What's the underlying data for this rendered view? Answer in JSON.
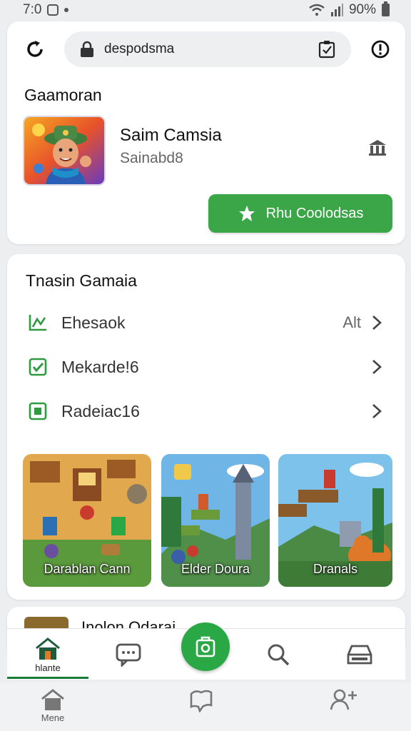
{
  "status_bar": {
    "time": "7:0",
    "battery_text": "90%"
  },
  "browser": {
    "url": "despodsma",
    "icons": [
      "reload-icon",
      "lock-icon",
      "clipboard-check-icon",
      "alert-icon"
    ]
  },
  "featured": {
    "section_title": "Gaamoran",
    "app_name": "Saim Camsia",
    "app_subtitle": "Sainabd8",
    "install_label": "Rhu Coolodsas",
    "accent": "#3ba647"
  },
  "trending": {
    "section_title": "Tnasin Gamaia",
    "items": [
      {
        "label": "Ehesaok",
        "value": "Alt",
        "icon": "chart-icon"
      },
      {
        "label": "Mekarde!6",
        "value": "",
        "icon": "check-square-icon"
      },
      {
        "label": "Radeiac16",
        "value": "",
        "icon": "square-icon"
      }
    ],
    "games": [
      {
        "caption": "Darablan Cann"
      },
      {
        "caption": "Elder Doura"
      },
      {
        "caption": "Dranals"
      }
    ]
  },
  "peek": {
    "title": "Inolon Odarai"
  },
  "app_nav": {
    "tabs": [
      {
        "label": "hlante",
        "icon": "home-icon"
      },
      {
        "label": "",
        "icon": "chat-icon"
      },
      {
        "label": "",
        "icon": "camera-icon"
      },
      {
        "label": "",
        "icon": "search-icon"
      },
      {
        "label": "",
        "icon": "inbox-icon"
      }
    ]
  },
  "system_nav": {
    "tabs": [
      {
        "label": "Mene",
        "icon": "home-icon"
      },
      {
        "label": "",
        "icon": "map-icon"
      },
      {
        "label": "",
        "icon": "people-icon"
      }
    ]
  }
}
